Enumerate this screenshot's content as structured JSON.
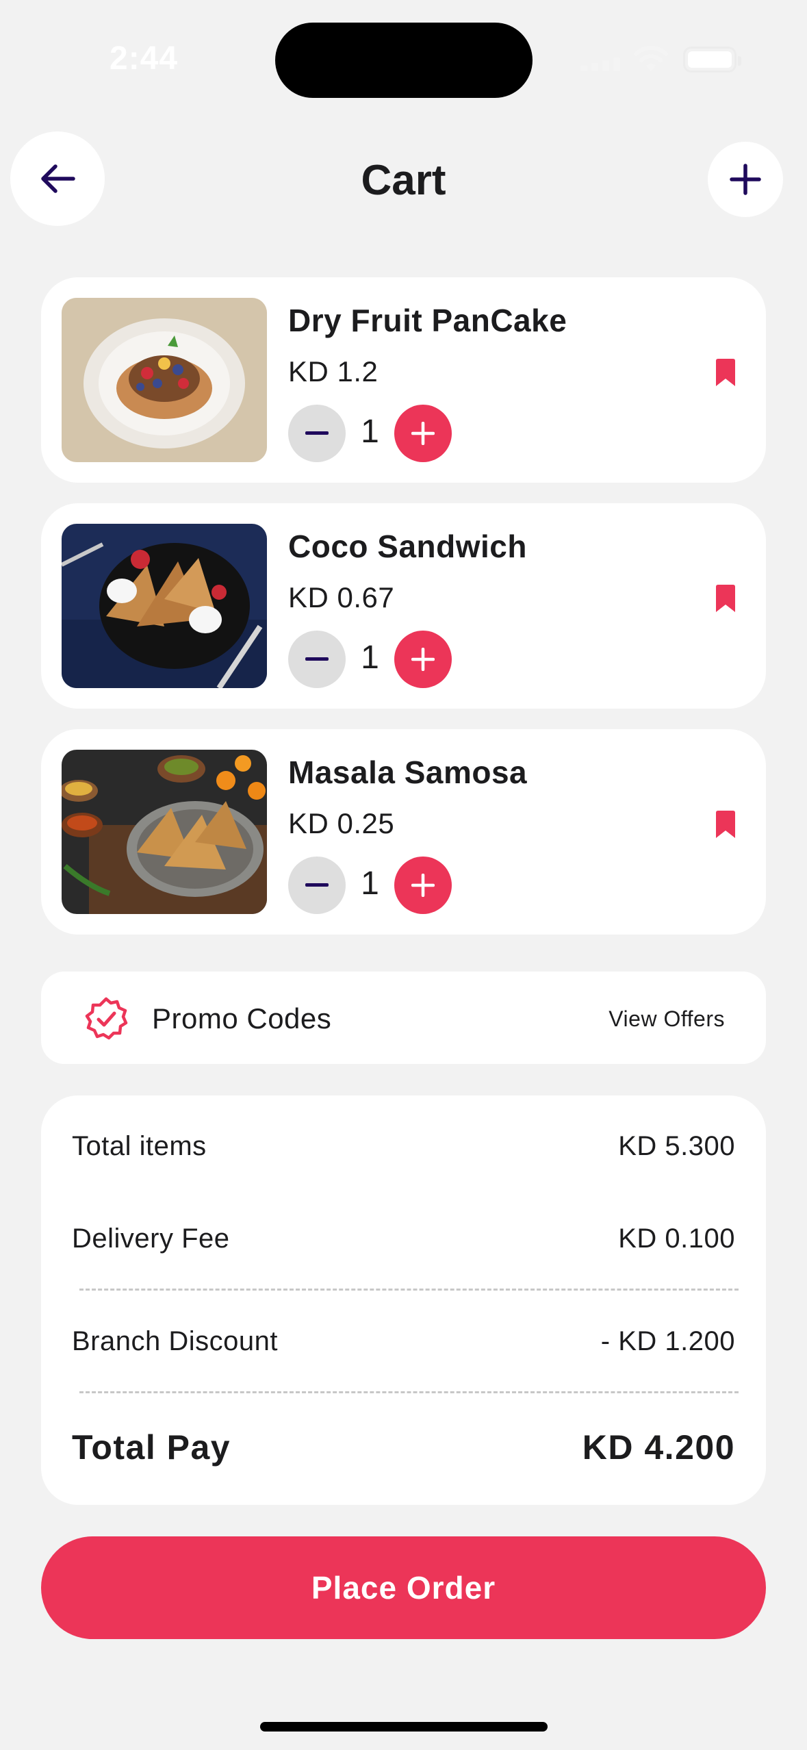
{
  "status_bar": {
    "time": "2:44"
  },
  "header": {
    "title": "Cart"
  },
  "cart_items": [
    {
      "name": "Dry Fruit PanCake",
      "price": "KD 1.2",
      "quantity": "1"
    },
    {
      "name": "Coco Sandwich",
      "price": "KD 0.67",
      "quantity": "1"
    },
    {
      "name": "Masala Samosa",
      "price": "KD 0.25",
      "quantity": "1"
    }
  ],
  "promo": {
    "label": "Promo Codes",
    "action": "View Offers"
  },
  "summary": {
    "total_items_label": "Total items",
    "total_items_value": "KD 5.300",
    "delivery_label": "Delivery Fee",
    "delivery_value": "KD 0.100",
    "discount_label": "Branch Discount",
    "discount_value": "- KD 1.200",
    "total_label": "Total Pay",
    "total_value": "KD 4.200"
  },
  "cta": {
    "label": "Place Order"
  },
  "colors": {
    "accent": "#ec3558",
    "icon_dark": "#1f0a5c",
    "background": "#f2f2f2"
  }
}
